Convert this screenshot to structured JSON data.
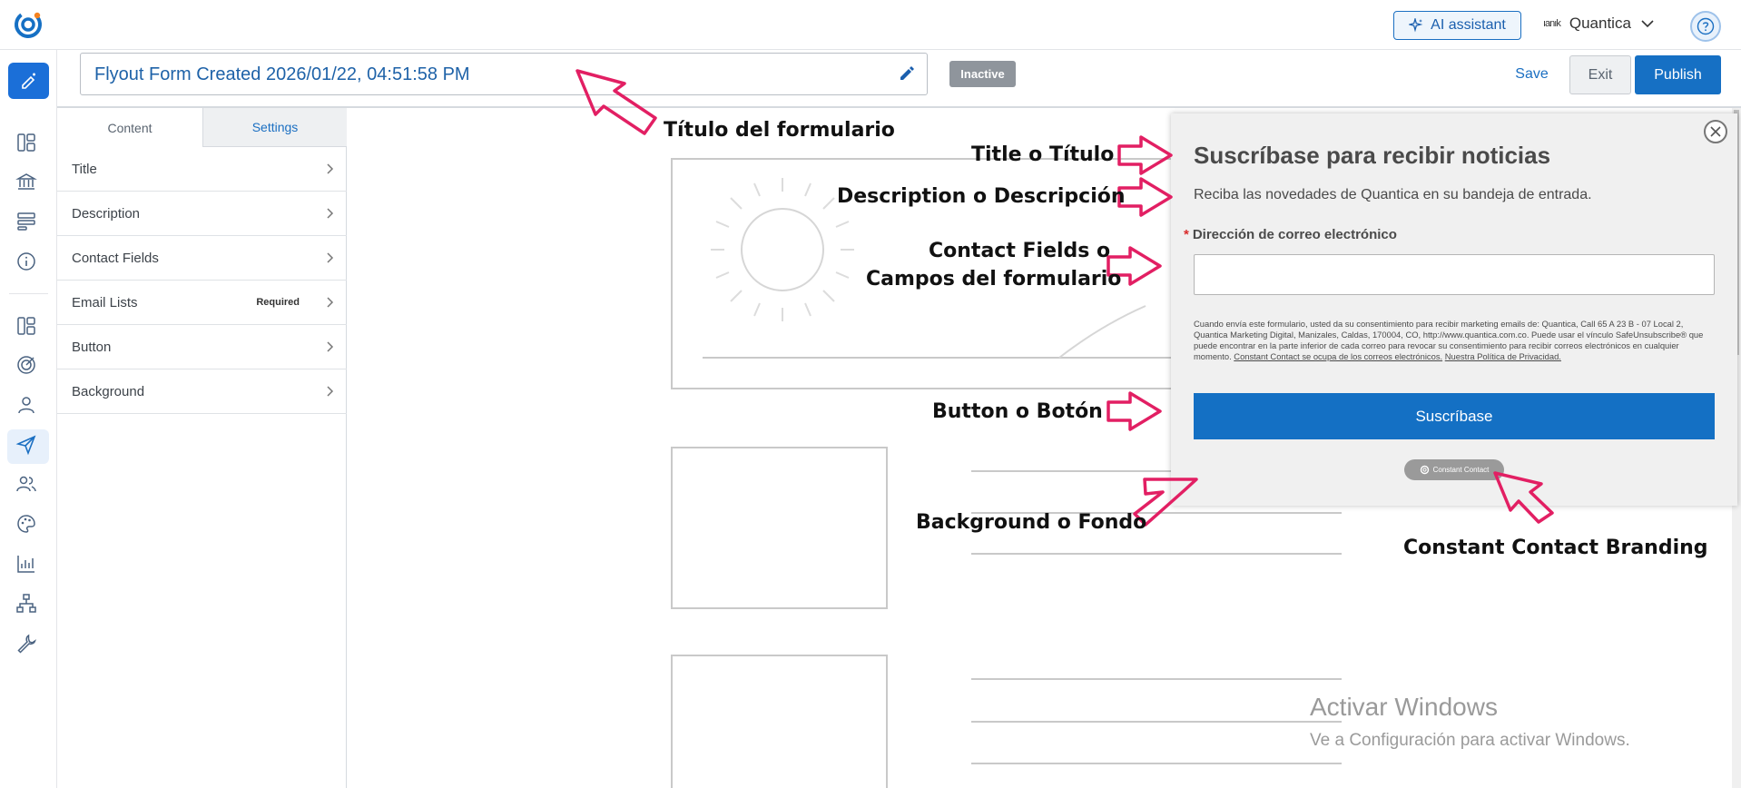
{
  "topbar": {
    "ai_assistant_label": "AI assistant",
    "account_mini_logo": "ıanık",
    "account_name": "Quantica"
  },
  "form": {
    "title": "Flyout Form Created 2026/01/22, 04:51:58 PM",
    "status_badge": "Inactive",
    "save_label": "Save",
    "exit_label": "Exit",
    "publish_label": "Publish"
  },
  "panel": {
    "tabs": [
      {
        "label": "Content"
      },
      {
        "label": "Settings"
      }
    ],
    "items": [
      {
        "label": "Title",
        "tag": ""
      },
      {
        "label": "Description",
        "tag": ""
      },
      {
        "label": "Contact Fields",
        "tag": ""
      },
      {
        "label": "Email Lists",
        "tag": "Required"
      },
      {
        "label": "Button",
        "tag": ""
      },
      {
        "label": "Background",
        "tag": ""
      }
    ]
  },
  "flyout": {
    "title": "Suscríbase para recibir noticias",
    "description": "Reciba las novedades de Quantica en su bandeja de entrada.",
    "email_label": "Dirección de correo electrónico",
    "required_mark": "*",
    "email_value": "",
    "legal_text": "Cuando envía este formulario, usted da su consentimiento para recibir marketing emails de: Quantica, Call 65 A 23 B - 07 Local 2, Quantica Marketing Digital, Manizales, Caldas, 170004, CO, http://www.quantica.com.co. Puede usar el vínculo SafeUnsubscribe® que puede encontrar en la parte inferior de cada correo para revocar su consentimiento para recibir correos electrónicos en cualquier momento.",
    "legal_link_1": "Constant Contact se ocupa de los correos electrónicos.",
    "legal_link_2": "Nuestra Política de Privacidad.",
    "button_label": "Suscríbase",
    "branding_label": "Constant Contact"
  },
  "annotations": {
    "form_title": "Título del formulario",
    "title": "Title o Título",
    "description": "Description o Descripción",
    "contact_fields_1": "Contact Fields o",
    "contact_fields_2": "Campos del formulario",
    "button": "Button o Botón",
    "background": "Background o Fondo",
    "branding": "Constant Contact Branding"
  },
  "watermark": {
    "line1": "Activar Windows",
    "line2": "Ve a Configuración para activar Windows."
  },
  "colors": {
    "brand_blue": "#1670c4",
    "annotation_arrow": "#e21f63",
    "inactive_badge": "#8f959c"
  },
  "icons": [
    "ctct-logo",
    "sparkle-icon",
    "chevron-down-icon",
    "help-icon",
    "pencil-icon",
    "chevron-right-icon",
    "close-icon"
  ]
}
